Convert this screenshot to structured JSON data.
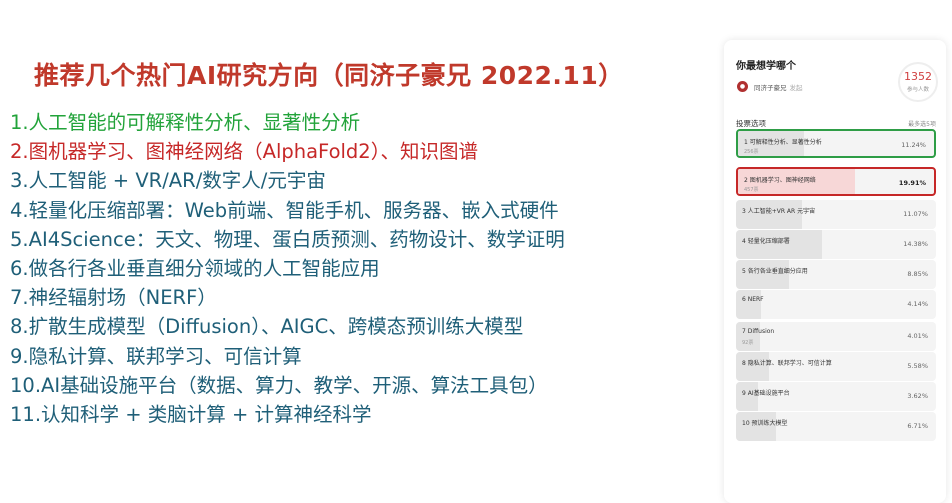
{
  "slide": {
    "title": "推荐几个热门AI研究方向（同济子豪兄 2022.11）",
    "items": [
      {
        "num": "1.",
        "text": "人工智能的可解释性分析、显著性分析",
        "color": "#22a33a"
      },
      {
        "num": "2.",
        "text": "图机器学习、图神经网络（AlphaFold2）、知识图谱",
        "color": "#c62828"
      },
      {
        "num": "3.",
        "text": "人工智能 + VR/AR/数字人/元宇宙",
        "color": "#1f5f78"
      },
      {
        "num": "4.",
        "text": "轻量化压缩部署：Web前端、智能手机、服务器、嵌入式硬件",
        "color": "#1f5f78"
      },
      {
        "num": "5.",
        "text": "AI4Science：天文、物理、蛋白质预测、药物设计、数学证明",
        "color": "#1f5f78"
      },
      {
        "num": "6.",
        "text": "做各行各业垂直细分领域的人工智能应用",
        "color": "#1f5f78"
      },
      {
        "num": "7.",
        "text": "神经辐射场（NERF）",
        "color": "#1f5f78"
      },
      {
        "num": "8.",
        "text": "扩散生成模型（Diffusion）、AIGC、跨模态预训练大模型",
        "color": "#1f5f78"
      },
      {
        "num": "9.",
        "text": "隐私计算、联邦学习、可信计算",
        "color": "#1f5f78"
      },
      {
        "num": "10.",
        "text": "AI基础设施平台（数据、算力、教学、开源、算法工具包）",
        "color": "#1f5f78"
      },
      {
        "num": "11.",
        "text": "认知科学 + 类脑计算 + 计算神经科学",
        "color": "#1f5f78"
      }
    ]
  },
  "poll": {
    "question": "你最想学哪个",
    "author": "同济子豪兄",
    "author_meta": "发起",
    "participant_count": "1352",
    "participant_label": "参与人数",
    "options_heading": "投票选项",
    "options_note": "最多选5项",
    "options": [
      {
        "label": "1 可解释性分析、显著性分析",
        "votes": "256票",
        "percent": "11.24%",
        "share": 0.1124,
        "highlight": "green"
      },
      {
        "label": "2 图机器学习、图神经网络",
        "votes": "457票",
        "percent": "19.91%",
        "share": 0.1991,
        "highlight": "red"
      },
      {
        "label": "3 人工智能+VR AR 元宇宙",
        "votes": "",
        "percent": "11.07%",
        "share": 0.1107,
        "highlight": ""
      },
      {
        "label": "4 轻量化压缩部署",
        "votes": "",
        "percent": "14.38%",
        "share": 0.1438,
        "highlight": ""
      },
      {
        "label": "5 各行各业垂直细分应用",
        "votes": "",
        "percent": "8.85%",
        "share": 0.0885,
        "highlight": ""
      },
      {
        "label": "6 NERF",
        "votes": "",
        "percent": "4.14%",
        "share": 0.0414,
        "highlight": ""
      },
      {
        "label": "7 Diffusion",
        "votes": "92票",
        "percent": "4.01%",
        "share": 0.0401,
        "highlight": ""
      },
      {
        "label": "8 隐私计算、联邦学习、可信计算",
        "votes": "",
        "percent": "5.58%",
        "share": 0.0558,
        "highlight": ""
      },
      {
        "label": "9 AI基础设施平台",
        "votes": "",
        "percent": "3.62%",
        "share": 0.0362,
        "highlight": ""
      },
      {
        "label": "10 预训练大模型",
        "votes": "",
        "percent": "6.71%",
        "share": 0.0671,
        "highlight": ""
      }
    ]
  }
}
